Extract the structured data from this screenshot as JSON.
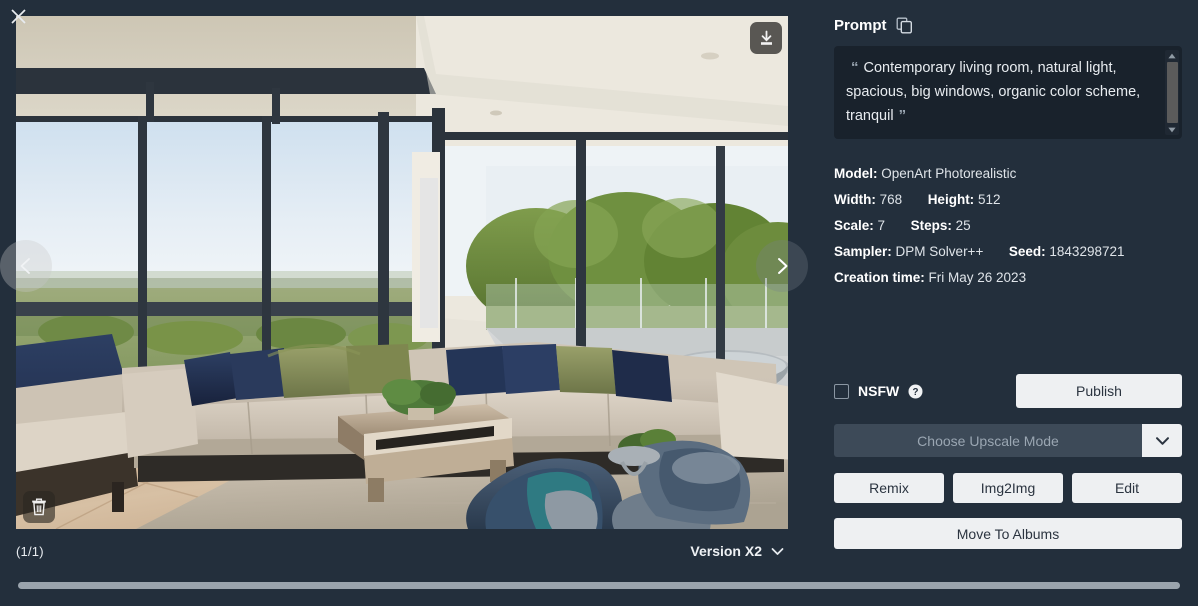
{
  "window": {
    "close_icon": "close-icon",
    "background_color": "#232f3c"
  },
  "viewer": {
    "download_icon": "download-icon",
    "delete_icon": "trash-icon",
    "prev_icon": "chevron-left-icon",
    "next_icon": "chevron-right-icon",
    "counter": "(1/1)",
    "version_label": "Version X2",
    "version_caret_icon": "chevron-down-icon",
    "image_alt": "Contemporary living room with floor-to-ceiling windows, beige sectional sofa, navy armchairs and textured area rug"
  },
  "prompt": {
    "title": "Prompt",
    "copy_icon": "copy-icon",
    "open_quote": "“",
    "close_quote": "”",
    "text": "Contemporary living room, natural light, spacious, big windows, organic color scheme, tranquil",
    "scroll_up_icon": "triangle-up-icon",
    "scroll_down_icon": "triangle-down-icon"
  },
  "metadata": [
    {
      "label": "Model:",
      "value": "OpenArt Photorealistic"
    },
    {
      "label": "Width:",
      "value": "768",
      "label2": "Height:",
      "value2": "512"
    },
    {
      "label": "Scale:",
      "value": "7",
      "label2": "Steps:",
      "value2": "25"
    },
    {
      "label": "Sampler:",
      "value": "DPM Solver++",
      "label2": "Seed:",
      "value2": "1843298721"
    },
    {
      "label": "Creation time:",
      "value": "Fri May 26 2023"
    }
  ],
  "meta_flat": {
    "model_label": "Model:",
    "model_value": "OpenArt Photorealistic",
    "width_label": "Width:",
    "width_value": "768",
    "height_label": "Height:",
    "height_value": "512",
    "scale_label": "Scale:",
    "scale_value": "7",
    "steps_label": "Steps:",
    "steps_value": "25",
    "sampler_label": "Sampler:",
    "sampler_value": "DPM Solver++",
    "seed_label": "Seed:",
    "seed_value": "1843298721",
    "creation_label": "Creation time:",
    "creation_value": "Fri May 26 2023"
  },
  "actions": {
    "nsfw_label": "NSFW",
    "nsfw_checked": false,
    "help_icon": "question-mark-icon",
    "publish_label": "Publish",
    "upscale_placeholder": "Choose Upscale Mode",
    "upscale_caret_icon": "chevron-down-icon",
    "remix_label": "Remix",
    "img2img_label": "Img2Img",
    "edit_label": "Edit",
    "move_to_albums_label": "Move To Albums"
  },
  "scrollbars": {
    "horizontal": "page-horizontal-scrollbar"
  },
  "colors": {
    "panel_bg": "#232f3c",
    "prompt_bg": "#19222c",
    "button_bg": "#eef0f2",
    "button_text": "#2b3440",
    "upscale_field_bg": "#3d4a58",
    "placeholder_text": "#9aa6b2"
  }
}
